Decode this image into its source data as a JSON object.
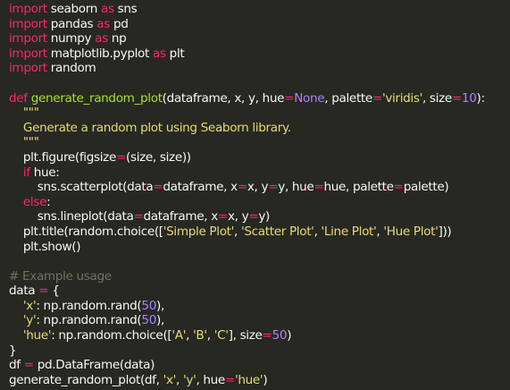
{
  "theme": {
    "background": "#272822",
    "foreground": "#f8f8f2",
    "keyword": "#f92672",
    "function": "#a6e22e",
    "string": "#e6db74",
    "number": "#ae81ff",
    "comment": "#75715e"
  },
  "lines": [
    [
      [
        "kw",
        "import"
      ],
      [
        "plain",
        " seaborn "
      ],
      [
        "kw",
        "as"
      ],
      [
        "plain",
        " sns"
      ]
    ],
    [
      [
        "kw",
        "import"
      ],
      [
        "plain",
        " pandas "
      ],
      [
        "kw",
        "as"
      ],
      [
        "plain",
        " pd"
      ]
    ],
    [
      [
        "kw",
        "import"
      ],
      [
        "plain",
        " numpy "
      ],
      [
        "kw",
        "as"
      ],
      [
        "plain",
        " np"
      ]
    ],
    [
      [
        "kw",
        "import"
      ],
      [
        "plain",
        " matplotlib.pyplot "
      ],
      [
        "kw",
        "as"
      ],
      [
        "plain",
        " plt"
      ]
    ],
    [
      [
        "kw",
        "import"
      ],
      [
        "plain",
        " random"
      ]
    ],
    [],
    [
      [
        "kw",
        "def"
      ],
      [
        "plain",
        " "
      ],
      [
        "fn",
        "generate_random_plot"
      ],
      [
        "plain",
        "(dataframe, x, y, hue"
      ],
      [
        "op",
        "="
      ],
      [
        "num",
        "None"
      ],
      [
        "plain",
        ", palette"
      ],
      [
        "op",
        "="
      ],
      [
        "str",
        "'viridis'"
      ],
      [
        "plain",
        ", size"
      ],
      [
        "op",
        "="
      ],
      [
        "num",
        "10"
      ],
      [
        "plain",
        "):"
      ]
    ],
    [
      [
        "plain",
        "    "
      ],
      [
        "str",
        "\"\"\""
      ]
    ],
    [
      [
        "str",
        "    Generate a random plot using Seaborn library."
      ]
    ],
    [
      [
        "str",
        "    \"\"\""
      ]
    ],
    [
      [
        "plain",
        "    plt.figure(figsize"
      ],
      [
        "op",
        "="
      ],
      [
        "plain",
        "(size, size))"
      ]
    ],
    [
      [
        "plain",
        "    "
      ],
      [
        "kw",
        "if"
      ],
      [
        "plain",
        " hue:"
      ]
    ],
    [
      [
        "plain",
        "        sns.scatterplot(data"
      ],
      [
        "op",
        "="
      ],
      [
        "plain",
        "dataframe, x"
      ],
      [
        "op",
        "="
      ],
      [
        "plain",
        "x, y"
      ],
      [
        "op",
        "="
      ],
      [
        "plain",
        "y, hue"
      ],
      [
        "op",
        "="
      ],
      [
        "plain",
        "hue, palette"
      ],
      [
        "op",
        "="
      ],
      [
        "plain",
        "palette)"
      ]
    ],
    [
      [
        "plain",
        "    "
      ],
      [
        "kw",
        "else"
      ],
      [
        "plain",
        ":"
      ]
    ],
    [
      [
        "plain",
        "        sns.lineplot(data"
      ],
      [
        "op",
        "="
      ],
      [
        "plain",
        "dataframe, x"
      ],
      [
        "op",
        "="
      ],
      [
        "plain",
        "x, y"
      ],
      [
        "op",
        "="
      ],
      [
        "plain",
        "y)"
      ]
    ],
    [
      [
        "plain",
        "    plt.title(random.choice(["
      ],
      [
        "str",
        "'Simple Plot'"
      ],
      [
        "plain",
        ", "
      ],
      [
        "str",
        "'Scatter Plot'"
      ],
      [
        "plain",
        ", "
      ],
      [
        "str",
        "'Line Plot'"
      ],
      [
        "plain",
        ", "
      ],
      [
        "str",
        "'Hue Plot'"
      ],
      [
        "plain",
        "]))"
      ]
    ],
    [
      [
        "plain",
        "    plt.show()"
      ]
    ],
    [],
    [
      [
        "cm",
        "# Example usage"
      ]
    ],
    [
      [
        "plain",
        "data "
      ],
      [
        "op",
        "="
      ],
      [
        "plain",
        " {"
      ]
    ],
    [
      [
        "plain",
        "    "
      ],
      [
        "str",
        "'x'"
      ],
      [
        "plain",
        ": np.random.rand("
      ],
      [
        "num",
        "50"
      ],
      [
        "plain",
        "),"
      ]
    ],
    [
      [
        "plain",
        "    "
      ],
      [
        "str",
        "'y'"
      ],
      [
        "plain",
        ": np.random.rand("
      ],
      [
        "num",
        "50"
      ],
      [
        "plain",
        "),"
      ]
    ],
    [
      [
        "plain",
        "    "
      ],
      [
        "str",
        "'hue'"
      ],
      [
        "plain",
        ": np.random.choice(["
      ],
      [
        "str",
        "'A'"
      ],
      [
        "plain",
        ", "
      ],
      [
        "str",
        "'B'"
      ],
      [
        "plain",
        ", "
      ],
      [
        "str",
        "'C'"
      ],
      [
        "plain",
        "], size"
      ],
      [
        "op",
        "="
      ],
      [
        "num",
        "50"
      ],
      [
        "plain",
        ")"
      ]
    ],
    [
      [
        "plain",
        "}"
      ]
    ],
    [
      [
        "plain",
        "df "
      ],
      [
        "op",
        "="
      ],
      [
        "plain",
        " pd.DataFrame(data)"
      ]
    ],
    [
      [
        "plain",
        "generate_random_plot(df, "
      ],
      [
        "str",
        "'x'"
      ],
      [
        "plain",
        ", "
      ],
      [
        "str",
        "'y'"
      ],
      [
        "plain",
        ", hue"
      ],
      [
        "op",
        "="
      ],
      [
        "str",
        "'hue'"
      ],
      [
        "plain",
        ")"
      ]
    ]
  ]
}
